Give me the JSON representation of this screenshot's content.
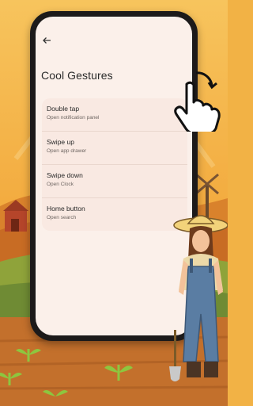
{
  "screen": {
    "back_icon": "arrow-left-icon",
    "title": "Cool Gestures"
  },
  "gestures": [
    {
      "title": "Double tap",
      "subtitle": "Open notification panel"
    },
    {
      "title": "Swipe up",
      "subtitle": "Open app drawer"
    },
    {
      "title": "Swipe down",
      "subtitle": "Open Clock"
    },
    {
      "title": "Home button",
      "subtitle": "Open search"
    }
  ],
  "colors": {
    "screen_bg": "#fbf0ea",
    "list_bg": "#f9e9e2",
    "phone_frame": "#1c1a1a",
    "sky": "#f2b245",
    "field": "#c8742a"
  },
  "decor": {
    "hand_icon": "tap-hand-icon",
    "farmer": "farmer-illustration",
    "barn": "barn-illustration",
    "windmill": "windmill-illustration"
  }
}
